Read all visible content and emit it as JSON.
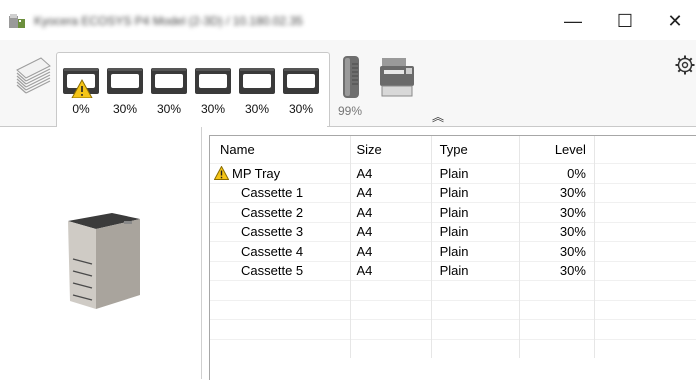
{
  "window": {
    "title": "Kyocera ECOSYS P4 Model (2-3D) / 10.180.02.35",
    "minimize_glyph": "—",
    "maximize_glyph": "☐",
    "close_glyph": "✕"
  },
  "icons": {
    "app": "printer-app-icon",
    "paper_stack": "paper-stack-icon",
    "tray": "paper-tray-icon",
    "warning": "warning-triangle-icon",
    "toner": "toner-cartridge-icon",
    "device": "printer-device-icon",
    "collapse": "chevron-up-icon",
    "settings": "gear-icon"
  },
  "trays": [
    {
      "percent": "0%",
      "warning": true
    },
    {
      "percent": "30%",
      "warning": false
    },
    {
      "percent": "30%",
      "warning": false
    },
    {
      "percent": "30%",
      "warning": false
    },
    {
      "percent": "30%",
      "warning": false
    },
    {
      "percent": "30%",
      "warning": false
    }
  ],
  "toner": {
    "percent": "99%",
    "level": 0.99
  },
  "collapse_glyph": "︽",
  "table": {
    "headers": {
      "name": "Name",
      "size": "Size",
      "type": "Type",
      "level": "Level"
    },
    "rows": [
      {
        "name": "MP Tray",
        "size": "A4",
        "type": "Plain",
        "level": "0%",
        "warning": true
      },
      {
        "name": "Cassette 1",
        "size": "A4",
        "type": "Plain",
        "level": "30%",
        "warning": false
      },
      {
        "name": "Cassette 2",
        "size": "A4",
        "type": "Plain",
        "level": "30%",
        "warning": false
      },
      {
        "name": "Cassette 3",
        "size": "A4",
        "type": "Plain",
        "level": "30%",
        "warning": false
      },
      {
        "name": "Cassette 4",
        "size": "A4",
        "type": "Plain",
        "level": "30%",
        "warning": false
      },
      {
        "name": "Cassette 5",
        "size": "A4",
        "type": "Plain",
        "level": "30%",
        "warning": false
      }
    ]
  },
  "colors": {
    "warning_yellow": "#f5c518",
    "tray_dark": "#3a3a3a",
    "tab_border": "#c9c9c9"
  }
}
